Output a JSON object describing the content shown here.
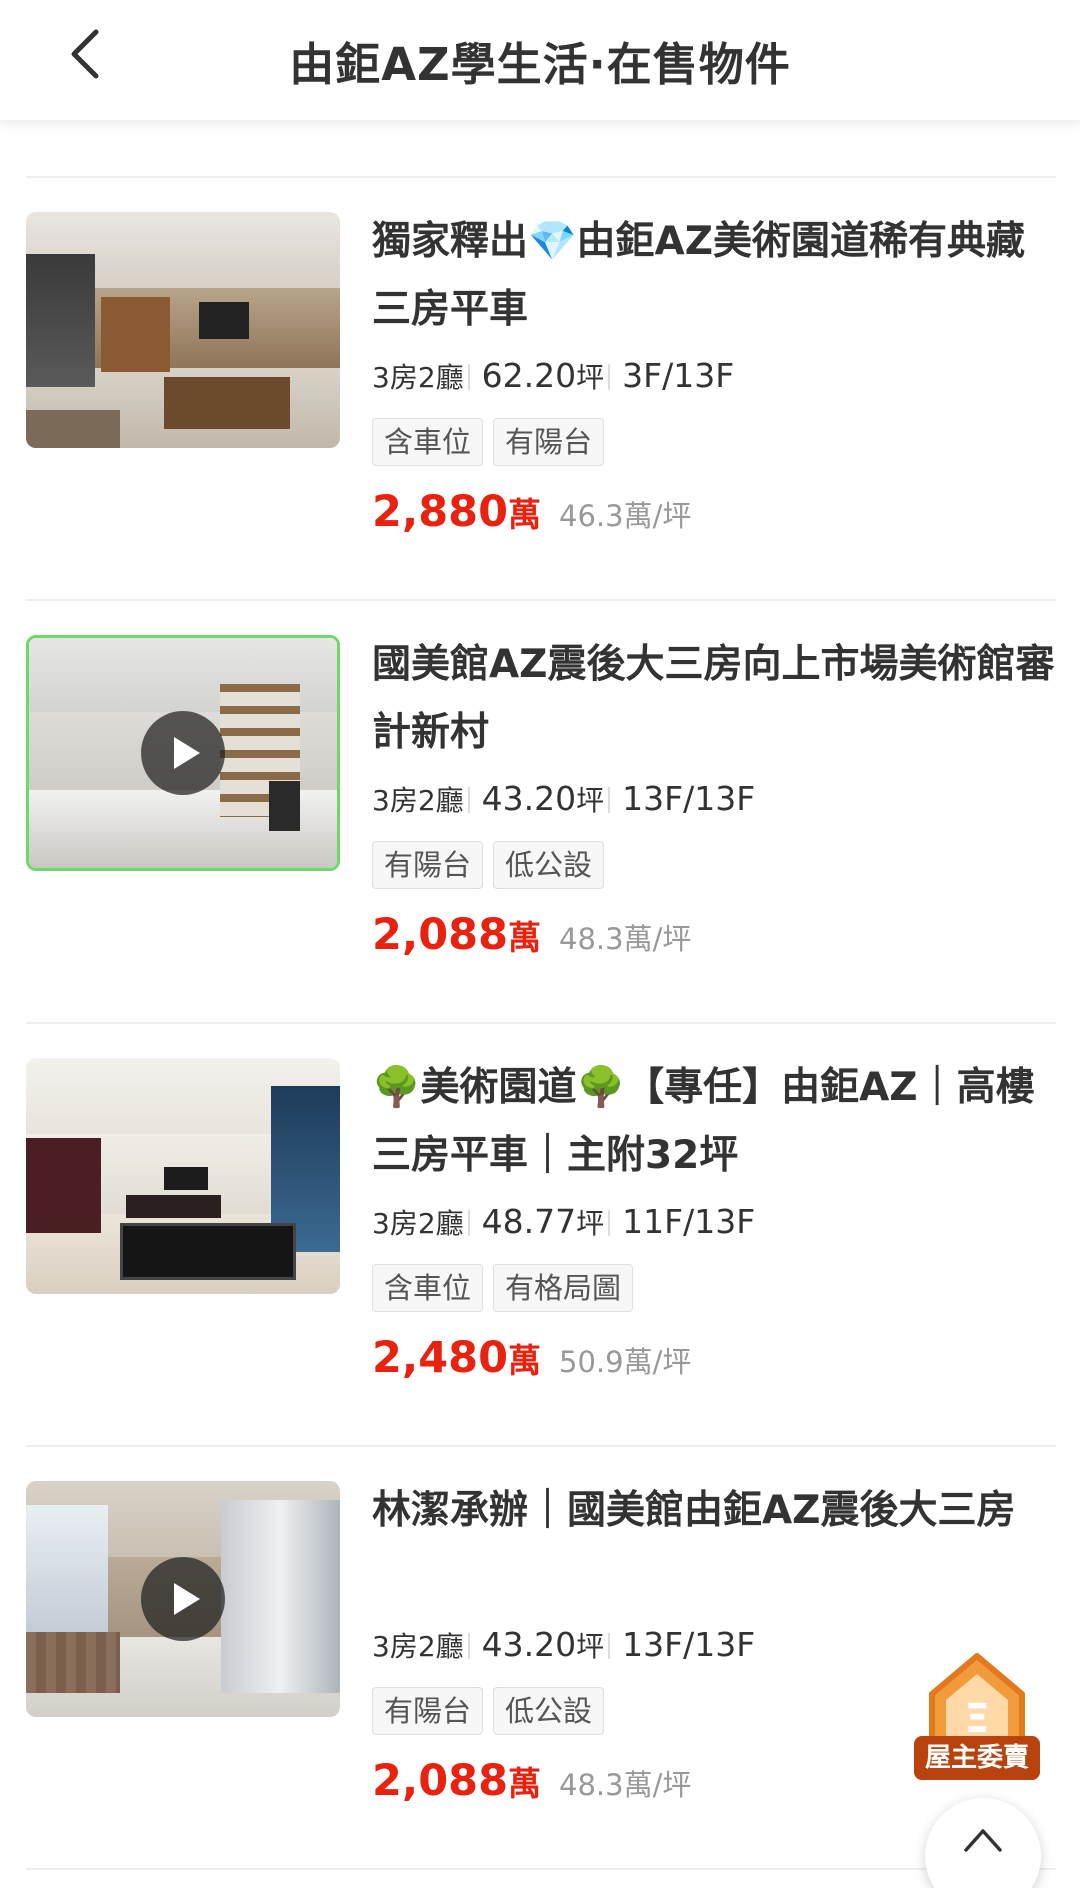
{
  "header": {
    "title": "由鉅AZ學生活·在售物件",
    "back_icon": "chevron-left-icon"
  },
  "listings": [
    {
      "title": "獨家釋出💎由鉅AZ美術園道稀有典藏三房平車",
      "rooms": "3房2廳",
      "area": "62.20",
      "area_unit": "坪",
      "floor": "3F/13F",
      "tags": [
        "含車位",
        "有陽台"
      ],
      "price": "2,880",
      "price_unit": "萬",
      "unit_price": "46.3萬/坪",
      "has_video": false
    },
    {
      "title": "國美館AZ震後大三房向上市場美術館審計新村",
      "rooms": "3房2廳",
      "area": "43.20",
      "area_unit": "坪",
      "floor": "13F/13F",
      "tags": [
        "有陽台",
        "低公設"
      ],
      "price": "2,088",
      "price_unit": "萬",
      "unit_price": "48.3萬/坪",
      "has_video": true
    },
    {
      "title": "🌳美術園道🌳【專任】由鉅AZ｜高樓三房平車｜主附32坪",
      "rooms": "3房2廳",
      "area": "48.77",
      "area_unit": "坪",
      "floor": "11F/13F",
      "tags": [
        "含車位",
        "有格局圖"
      ],
      "price": "2,480",
      "price_unit": "萬",
      "unit_price": "50.9萬/坪",
      "has_video": false
    },
    {
      "title": "林潔承辦｜國美館由鉅AZ震後大三房",
      "rooms": "3房2廳",
      "area": "43.20",
      "area_unit": "坪",
      "floor": "13F/13F",
      "tags": [
        "有陽台",
        "低公設"
      ],
      "price": "2,088",
      "price_unit": "萬",
      "unit_price": "48.3萬/坪",
      "has_video": true
    }
  ],
  "floating": {
    "owner_label": "屋主委賣",
    "owner_icon": "house-icon",
    "top_icon": "chevron-up-icon"
  },
  "colors": {
    "price": "#e8220f",
    "owner_badge": "#b8430e",
    "highlight_border": "#6fd86a"
  }
}
